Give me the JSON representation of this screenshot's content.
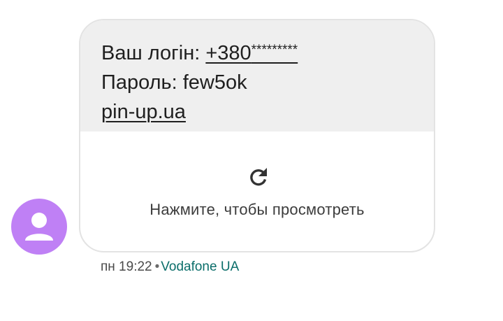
{
  "message": {
    "login_label": "Ваш логін: ",
    "login_number": "+380",
    "login_masked": "*********",
    "password_label": "Пароль: few5ok",
    "link": "pin-up.ua"
  },
  "preview": {
    "icon": "refresh-icon",
    "label": "Нажмите, чтобы просмотреть"
  },
  "meta": {
    "time": "пн 19:22",
    "separator": "•",
    "sender": "Vodafone UA"
  },
  "colors": {
    "avatar_bg": "#bf80f5",
    "bubble_text_bg": "#efefef",
    "sender_color": "#0b6e6a"
  }
}
